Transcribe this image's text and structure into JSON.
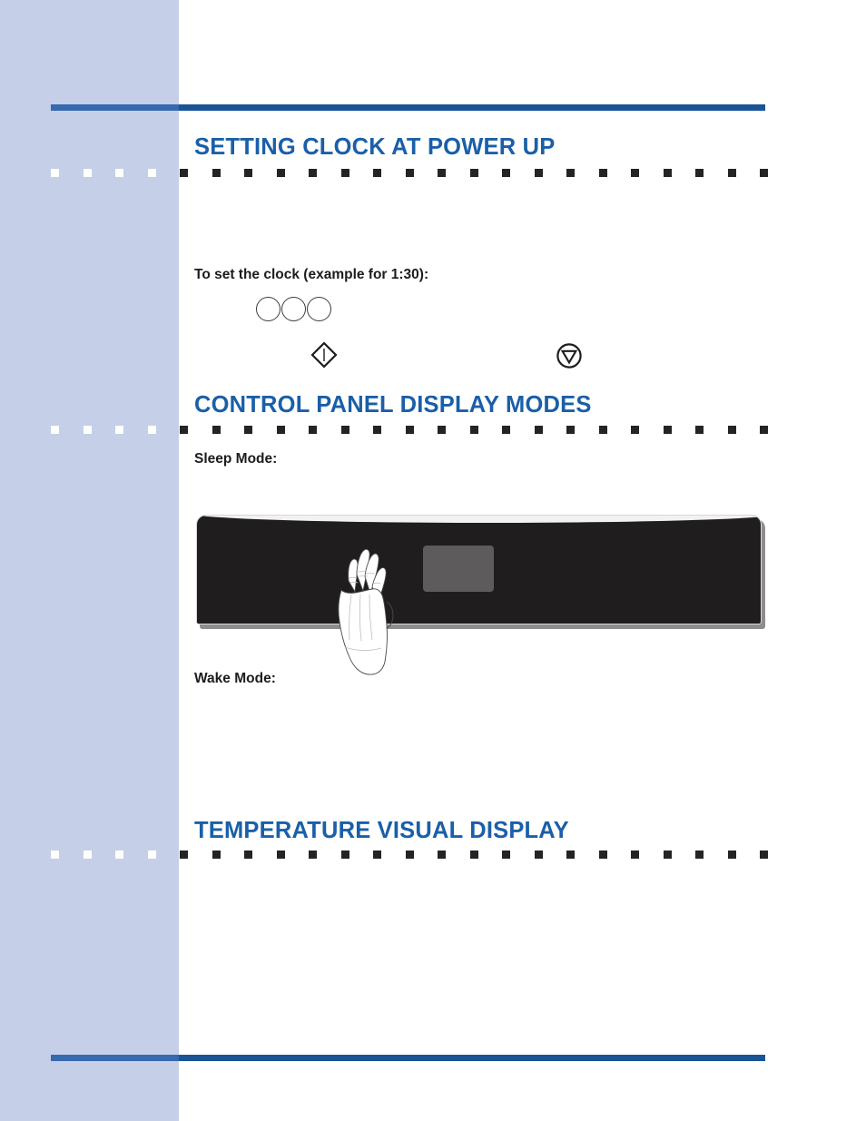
{
  "page": {
    "background_color": "#ffffff",
    "sidebar_color": "#c5cfe8",
    "accent_color": "#1a5496",
    "heading_color": "#1a5fa8",
    "body_text_color": "#1c1c1c"
  },
  "sections": [
    {
      "id": "setting-clock",
      "heading": "SETTING CLOCK AT POWER UP",
      "instruction": "To set the clock (example for 1:30):",
      "glyphs": {
        "rings": [
          "ring-1",
          "ring-2",
          "ring-3"
        ],
        "diamond_icon_name": "diamond-bar-icon",
        "circle_icon_name": "circle-down-triangle-icon"
      }
    },
    {
      "id": "control-panel-display-modes",
      "heading": "CONTROL PANEL DISPLAY MODES",
      "sleep_mode_label": "Sleep Mode:",
      "wake_mode_label": "Wake Mode:",
      "illustration": {
        "name": "oven-control-panel",
        "panel_color": "#1f1d1e",
        "display_color": "#5d5b5b",
        "hand_color": "#ffffff"
      }
    },
    {
      "id": "temperature-visual-display",
      "heading": "TEMPERATURE VISUAL DISPLAY"
    }
  ]
}
